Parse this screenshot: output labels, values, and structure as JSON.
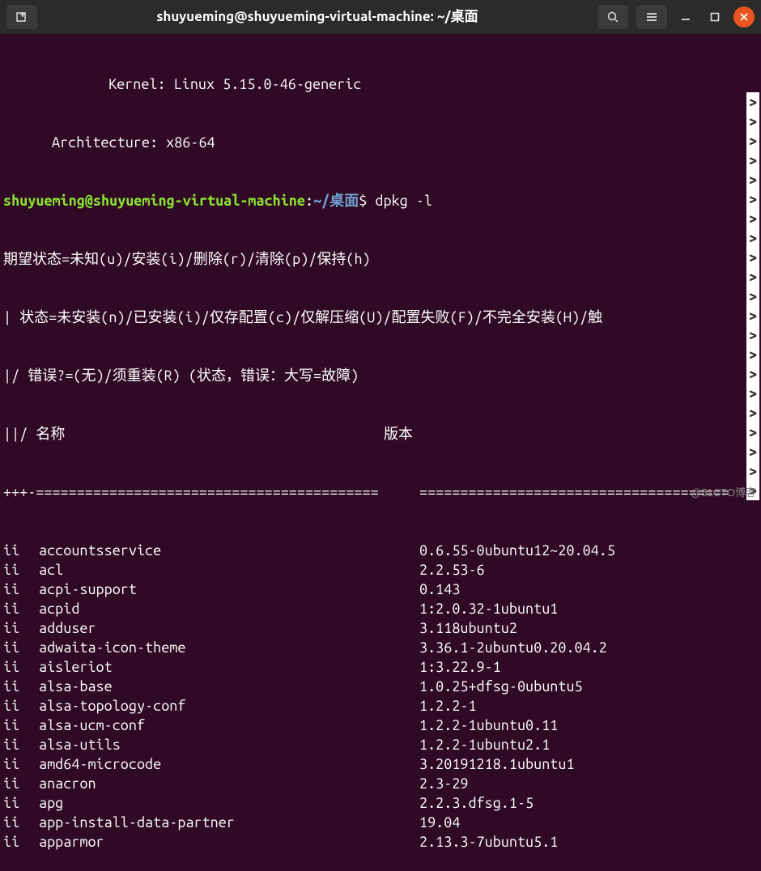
{
  "window": {
    "title": "shuyueming@shuyueming-virtual-machine: ~/桌面"
  },
  "header": {
    "kernel_label": "Kernel:",
    "kernel_value": "Linux 5.15.0-46-generic",
    "arch_label": "Architecture:",
    "arch_value": "x86-64"
  },
  "prompt": {
    "user_host": "shuyueming@shuyueming-virtual-machine",
    "colon": ":",
    "path": "~/桌面",
    "symbol": "$",
    "command": "dpkg -l"
  },
  "legend": {
    "l1": "期望状态=未知(u)/安装(i)/删除(r)/清除(p)/保持(h)",
    "l2": "| 状态=未安装(n)/已安装(i)/仅存配置(c)/仅解压缩(U)/配置失败(F)/不完全安装(H)/触",
    "l3": "|/ 错误?=(无)/须重装(R) (状态，错误：大写=故障)",
    "l4_left": "||/ 名称",
    "l4_right": "版本",
    "sep_left": "+++-==========================================",
    "sep_right": "======================================"
  },
  "packages": [
    {
      "st": "ii",
      "name": "accountsservice",
      "version": "0.6.55-0ubuntu12~20.04.5"
    },
    {
      "st": "ii",
      "name": "acl",
      "version": "2.2.53-6"
    },
    {
      "st": "ii",
      "name": "acpi-support",
      "version": "0.143"
    },
    {
      "st": "ii",
      "name": "acpid",
      "version": "1:2.0.32-1ubuntu1"
    },
    {
      "st": "ii",
      "name": "adduser",
      "version": "3.118ubuntu2"
    },
    {
      "st": "ii",
      "name": "adwaita-icon-theme",
      "version": "3.36.1-2ubuntu0.20.04.2"
    },
    {
      "st": "ii",
      "name": "aisleriot",
      "version": "1:3.22.9-1"
    },
    {
      "st": "ii",
      "name": "alsa-base",
      "version": "1.0.25+dfsg-0ubuntu5"
    },
    {
      "st": "ii",
      "name": "alsa-topology-conf",
      "version": "1.2.2-1"
    },
    {
      "st": "ii",
      "name": "alsa-ucm-conf",
      "version": "1.2.2-1ubuntu0.11"
    },
    {
      "st": "ii",
      "name": "alsa-utils",
      "version": "1.2.2-1ubuntu2.1"
    },
    {
      "st": "ii",
      "name": "amd64-microcode",
      "version": "3.20191218.1ubuntu1"
    },
    {
      "st": "ii",
      "name": "anacron",
      "version": "2.3-29"
    },
    {
      "st": "ii",
      "name": "apg",
      "version": "2.2.3.dfsg.1-5"
    },
    {
      "st": "ii",
      "name": "app-install-data-partner",
      "version": "19.04"
    },
    {
      "st": "ii",
      "name": "apparmor",
      "version": "2.13.3-7ubuntu5.1"
    }
  ],
  "watermark": "@51CTO博客"
}
